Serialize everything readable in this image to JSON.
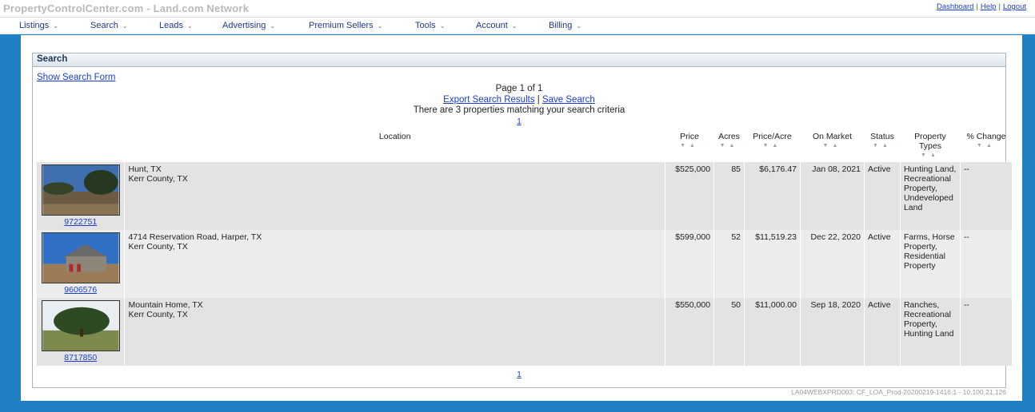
{
  "header": {
    "site_title": "PropertyControlCenter.com - Land.com Network",
    "links": [
      "Dashboard",
      "Help",
      "Logout"
    ]
  },
  "nav": {
    "items": [
      {
        "label": "Listings"
      },
      {
        "label": "Search"
      },
      {
        "label": "Leads"
      },
      {
        "label": "Advertising"
      },
      {
        "label": "Premium Sellers"
      },
      {
        "label": "Tools"
      },
      {
        "label": "Account"
      },
      {
        "label": "Billing"
      }
    ]
  },
  "search": {
    "title": "Search",
    "show_form": "Show Search Form",
    "page_info": "Page 1 of 1",
    "export_link": "Export Search Results",
    "separator": "|",
    "save_link": "Save Search",
    "summary": "There are 3 properties matching your search criteria",
    "page_link": "1"
  },
  "table": {
    "columns": [
      "Location",
      "Price",
      "Acres",
      "Price/Acre",
      "On Market",
      "Status",
      "Property Types",
      "% Change"
    ],
    "rows": [
      {
        "id": "9722751",
        "location_line1": "Hunt, TX",
        "location_line2": "Kerr County, TX",
        "price": "$525,000",
        "acres": "85",
        "price_per_acre": "$6,176.47",
        "on_market": "Jan 08, 2021",
        "status": "Active",
        "types": "Hunting Land, Recreational Property, Undeveloped Land",
        "change": "--"
      },
      {
        "id": "9606576",
        "location_line1": "4714 Reservation Road, Harper, TX",
        "location_line2": "Kerr County, TX",
        "price": "$599,000",
        "acres": "52",
        "price_per_acre": "$11,519.23",
        "on_market": "Dec 22, 2020",
        "status": "Active",
        "types": "Farms, Horse Property, Residential Property",
        "change": "--"
      },
      {
        "id": "8717850",
        "location_line1": "Mountain Home, TX",
        "location_line2": "Kerr County, TX",
        "price": "$550,000",
        "acres": "50",
        "price_per_acre": "$11,000.00",
        "on_market": "Sep 18, 2020",
        "status": "Active",
        "types": "Ranches, Recreational Property, Hunting Land",
        "change": "--"
      }
    ]
  },
  "footer": {
    "build": "LA04WEBXPRD003: CF_LOA_Prod-20200219-1416.1 - 10.100.21.126"
  },
  "colors": {
    "page_bg": "#1f81c4",
    "link": "#1a3fc8",
    "nav_text": "#1f3a8a",
    "row_a": "#e3e3e3",
    "row_b": "#ececec"
  },
  "icons": {
    "nav_dropdown": "chevron-down-icon",
    "sort": "sort-arrows-icon"
  }
}
